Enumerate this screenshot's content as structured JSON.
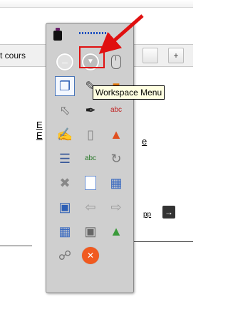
{
  "background": {
    "tab_text": "t cours",
    "tab_buttons": [
      "",
      "+"
    ],
    "links": [
      "E",
      "E",
      "e",
      "pp"
    ],
    "arrow_button": "→"
  },
  "toolbar": {
    "tooltip": "Workspace Menu",
    "rows": [
      [
        "minus-circle-icon",
        "workspace-menu-icon",
        "mouse-icon"
      ],
      [
        "copy-workspace-icon",
        "edit-workspace-icon",
        "page-orange-icon"
      ],
      [
        "pointer-icon",
        "pen-tool-icon",
        "spell-pen-icon"
      ],
      [
        "highlighter-icon",
        "eraser-icon",
        "shapes-icon"
      ],
      [
        "line-tool-icon",
        "text-object-icon",
        "rotate-icon"
      ],
      [
        "delete-icon",
        "new-page-icon",
        "table-icon"
      ],
      [
        "screen-capture-icon",
        "back-arrow-icon",
        "forward-arrow-icon"
      ],
      [
        "calendar-icon",
        "save-icon",
        "display-icon"
      ],
      [
        "link-tool-icon",
        "close-circle-icon",
        ""
      ]
    ]
  },
  "colors": {
    "toolbar_bg": "#cfcfcf",
    "highlight": "#e01010",
    "tooltip_bg": "#ffffe1"
  }
}
